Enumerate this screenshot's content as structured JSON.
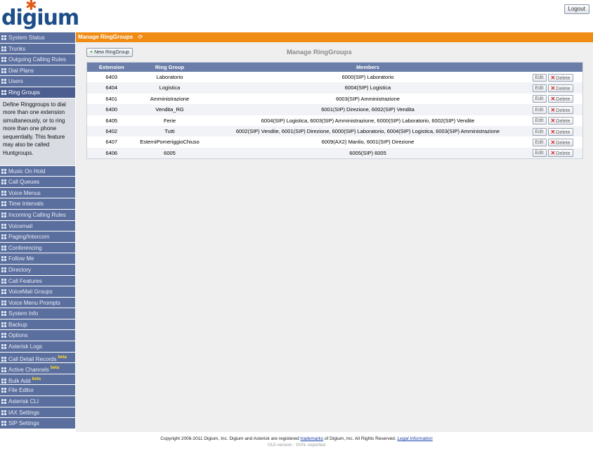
{
  "header": {
    "logo_text": "digium",
    "logout_label": "Logout"
  },
  "sidebar": {
    "items_before": [
      {
        "label": "System Status"
      },
      {
        "label": "Trunks"
      },
      {
        "label": "Outgoing Calling Rules"
      },
      {
        "label": "Dial Plans"
      },
      {
        "label": "Users"
      },
      {
        "label": "Ring Groups",
        "active": true
      }
    ],
    "description": "Define Ringgroups to dial more than one extension simultaneously, or to ring more than one phone sequentially. This feature may also be called Huntgroups.",
    "items_after": [
      {
        "label": "Music On Hold"
      },
      {
        "label": "Call Queues"
      },
      {
        "label": "Voice Menus"
      },
      {
        "label": "Time Intervals"
      },
      {
        "label": "Incoming Calling Rules"
      },
      {
        "label": "Voicemail"
      },
      {
        "label": "Paging/Intercom"
      },
      {
        "label": "Conferencing"
      },
      {
        "label": "Follow Me"
      },
      {
        "label": "Directory"
      },
      {
        "label": "Call Features"
      },
      {
        "label": "VoiceMail Groups"
      },
      {
        "label": "Voice Menu Prompts"
      },
      {
        "label": "System Info"
      },
      {
        "label": "Backup"
      },
      {
        "label": "Options"
      },
      {
        "label": "Asterisk Logs"
      },
      {
        "label": "Call Detail Records",
        "badge": "beta"
      },
      {
        "label": "Active Channels",
        "badge": "beta"
      },
      {
        "label": "Bulk Add",
        "badge": "beta"
      },
      {
        "label": "File Editor"
      },
      {
        "label": "Asterisk CLI"
      },
      {
        "label": "IAX Settings"
      },
      {
        "label": "SIP Settings"
      }
    ]
  },
  "main": {
    "bar_title": "Manage RingGroups",
    "new_button_label": "New RingGroup",
    "heading": "Manage RingGroups",
    "columns": [
      "Extension",
      "Ring Group",
      "Members"
    ],
    "edit_label": "Edit",
    "delete_label": "Delete",
    "rows": [
      {
        "extension": "6403",
        "ring_group": "Laboratorio",
        "members": "6000(SIP) Laboratorio"
      },
      {
        "extension": "6404",
        "ring_group": "Logistica",
        "members": "6004(SIP) Logistica"
      },
      {
        "extension": "6401",
        "ring_group": "Amministrazione",
        "members": "6003(SIP) Amministrazione"
      },
      {
        "extension": "6400",
        "ring_group": "Vendita_RG",
        "members": "6001(SIP) Direzione, 6002(SIP) Vendita"
      },
      {
        "extension": "6405",
        "ring_group": "Ferie",
        "members": "6004(SIP) Logistica, 6003(SIP) Amministrazione, 6000(SIP) Laboratorio, 6002(SIP) Vendite"
      },
      {
        "extension": "6402",
        "ring_group": "Tutti",
        "members": "6002(SIP) Vendite, 6001(SIP) Direzione, 6000(SIP) Laboratorio, 6004(SIP) Logistica, 6003(SIP) Amministrazione"
      },
      {
        "extension": "6407",
        "ring_group": "EsterniPomeriggioChiuso",
        "members": "6009(AX2) Manlio, 6001(SIP) Direzione"
      },
      {
        "extension": "6406",
        "ring_group": "6005",
        "members": "6005(SIP) 6005"
      }
    ]
  },
  "footer": {
    "copyright_prefix": "Copyright 2006-2011 Digium, Inc. Digium and Asterisk are registered",
    "trademarks_link": "trademarks",
    "copyright_suffix": "of Digium, Inc. All Rights Reserved.",
    "legal_link": "Legal Information",
    "gui_version": "GUI-version : SVN--reported"
  },
  "colors": {
    "nav_bg": "#5b6f9e",
    "accent_orange": "#f08b14",
    "table_header": "#6a7ea9",
    "logo_blue": "#1d4e89",
    "logo_star": "#e25a16"
  }
}
